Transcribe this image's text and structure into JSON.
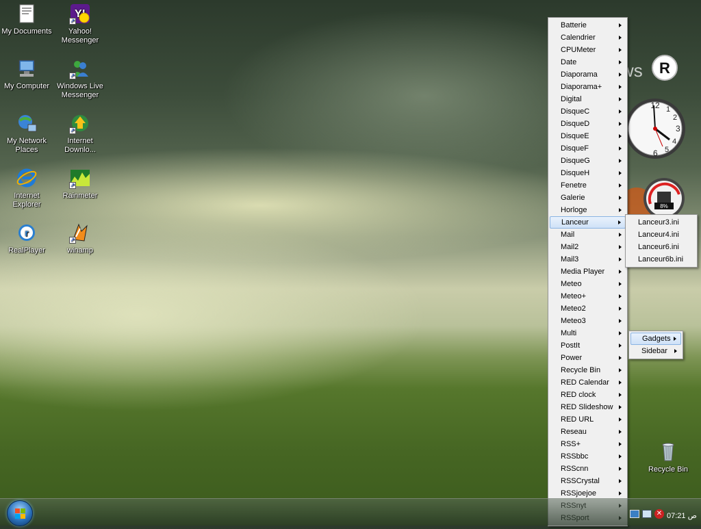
{
  "desktop_icons": [
    {
      "name": "my-documents",
      "label": "My Documents",
      "icon": "documents-icon"
    },
    {
      "name": "yahoo-messenger",
      "label": "Yahoo! Messenger",
      "icon": "yahoo-icon"
    },
    {
      "name": "my-computer",
      "label": "My Computer",
      "icon": "computer-icon"
    },
    {
      "name": "windows-live-messenger",
      "label": "Windows Live Messenger",
      "icon": "messenger-icon"
    },
    {
      "name": "my-network-places",
      "label": "My Network Places",
      "icon": "network-icon"
    },
    {
      "name": "internet-download",
      "label": "Internet Downlo...",
      "icon": "download-icon"
    },
    {
      "name": "internet-explorer",
      "label": "Internet Explorer",
      "icon": "ie-icon"
    },
    {
      "name": "rainmeter",
      "label": "Rainmeter",
      "icon": "rainmeter-icon"
    },
    {
      "name": "realplayer",
      "label": "RealPlayer",
      "icon": "realplayer-icon"
    },
    {
      "name": "winamp",
      "label": "winamp",
      "icon": "winamp-icon"
    }
  ],
  "recycle_bin": {
    "label": "Recycle Bin",
    "icon": "recycle-bin-icon"
  },
  "context_menu": {
    "items": [
      "Batterie",
      "Calendrier",
      "CPUMeter",
      "Date",
      "Diaporama",
      "Diaporama+",
      "Digital",
      "DisqueC",
      "DisqueD",
      "DisqueE",
      "DisqueF",
      "DisqueG",
      "DisqueH",
      "Fenetre",
      "Galerie",
      "Horloge",
      "Lanceur",
      "Mail",
      "Mail2",
      "Mail3",
      "Media Player",
      "Meteo",
      "Meteo+",
      "Meteo2",
      "Meteo3",
      "Multi",
      "PostIt",
      "Power",
      "Recycle Bin",
      "RED Calendar",
      "RED clock",
      "RED Slideshow",
      "RED URL",
      "Reseau",
      "RSS+",
      "RSSbbc",
      "RSScnn",
      "RSSCrystal",
      "RSSjoejoe",
      "RSSnyt",
      "RSSport"
    ],
    "highlighted": "Lanceur"
  },
  "lanceur_submenu": [
    "Lanceur3.ini",
    "Lanceur4.ini",
    "Lanceur6.ini",
    "Lanceur6b.ini"
  ],
  "gadgets_submenu": [
    "Gadgets",
    "Sidebar"
  ],
  "clock_gadget": {
    "numbers": [
      "12",
      "1",
      "2",
      "3",
      "4",
      "5",
      "6"
    ]
  },
  "gauge_gadget": {
    "label": "8%"
  },
  "taskbar": {
    "clock": "07:21 ص",
    "colors": {
      "accent": "#2a6fb8",
      "menu_bg": "#f0f0f0",
      "highlight": "#cfe2f7"
    }
  }
}
